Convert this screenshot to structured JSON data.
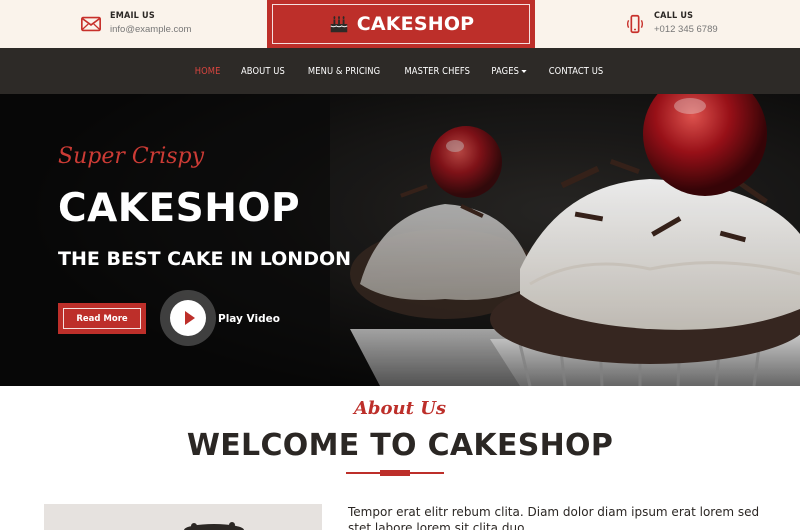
{
  "topbar": {
    "email": {
      "label": "EMAIL US",
      "value": "info@example.com",
      "icon": "envelope-icon"
    },
    "call": {
      "label": "CALL US",
      "value": "+012 345 6789",
      "icon": "phone-icon"
    }
  },
  "brand": {
    "name": "CAKESHOP",
    "icon": "birthday-cake-icon",
    "color": "#bd2f2a"
  },
  "nav": {
    "items": [
      {
        "label": "HOME",
        "active": true
      },
      {
        "label": "ABOUT US"
      },
      {
        "label": "MENU & PRICING"
      },
      {
        "label": "MASTER CHEFS"
      },
      {
        "label": "PAGES"
      },
      {
        "label": "CONTACT US"
      }
    ]
  },
  "hero": {
    "subtitle": "Super Crispy",
    "title": "CAKESHOP",
    "tagline": "THE BEST CAKE IN LONDON",
    "read_more": "Read More",
    "play_label": "Play Video"
  },
  "about": {
    "subtitle": "About Us",
    "title": "WELCOME TO CAKESHOP",
    "text": "Tempor erat elitr rebum clita. Diam dolor diam ipsum erat lorem sed stet labore lorem sit clita duo"
  },
  "colors": {
    "accent": "#bd2f2a",
    "nav_bg": "#2d2a27",
    "topbar_bg": "#faf3eb",
    "text_dark": "#2b2724"
  }
}
